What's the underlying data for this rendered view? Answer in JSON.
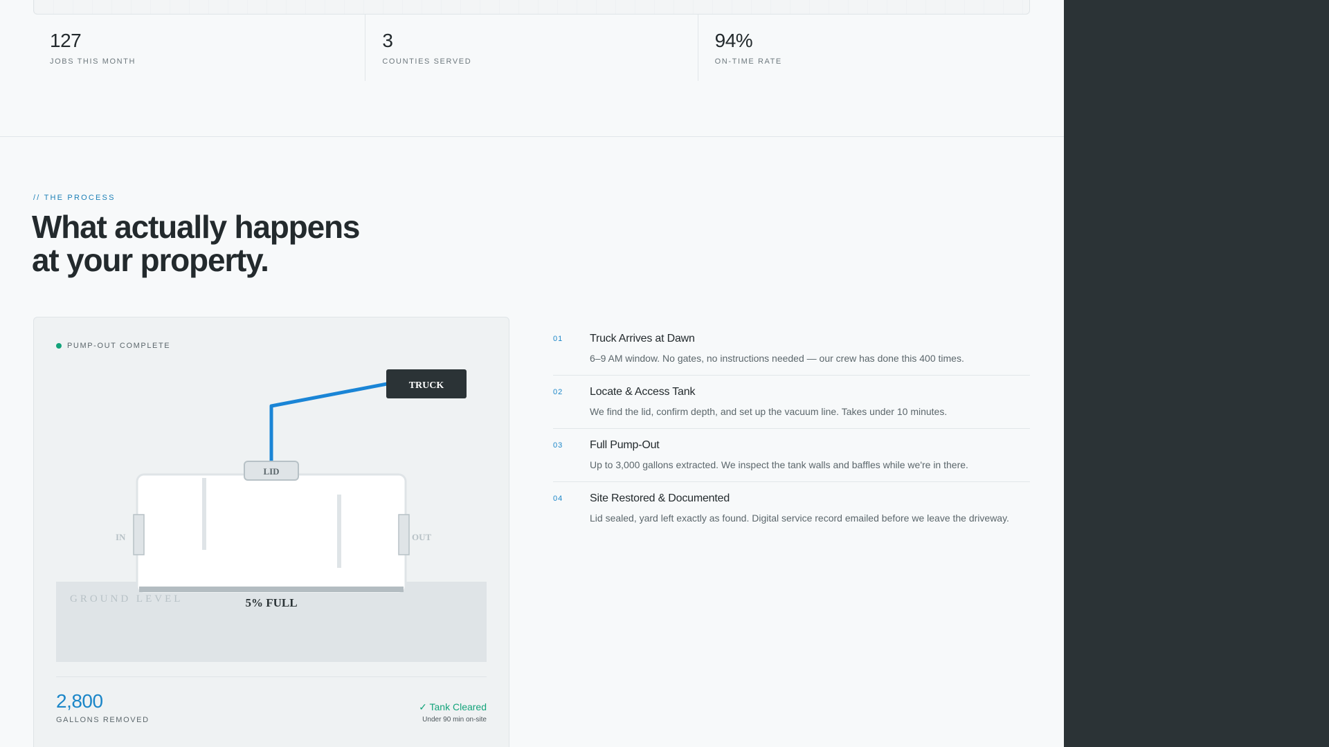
{
  "stats": [
    {
      "value": "127",
      "label": "JOBS THIS MONTH"
    },
    {
      "value": "3",
      "label": "COUNTIES SERVED"
    },
    {
      "value": "94%",
      "label": "ON-TIME RATE"
    }
  ],
  "process": {
    "eyebrow": "// THE PROCESS",
    "heading": "What actually happens\nat your property."
  },
  "diagram": {
    "status": "PUMP-OUT COMPLETE",
    "truck_label": "TRUCK",
    "lid_label": "LID",
    "in_label": "IN",
    "out_label": "OUT",
    "ground_label": "GROUND LEVEL",
    "fill_label": "5% FULL",
    "fill_fraction": 0.05,
    "gallons_value": "2,800",
    "gallons_label": "GALLONS REMOVED",
    "cleared_label": "✓ Tank Cleared",
    "cleared_sub": "Under 90 min on-site",
    "colors": {
      "hose": "#1a85d6",
      "status_dot": "#13a37a",
      "truck": "#2b3336"
    }
  },
  "steps": [
    {
      "num": "01",
      "title": "Truck Arrives at Dawn",
      "desc": "6–9 AM window. No gates, no instructions needed — our crew has done this 400 times."
    },
    {
      "num": "02",
      "title": "Locate & Access Tank",
      "desc": "We find the lid, confirm depth, and set up the vacuum line. Takes under 10 minutes."
    },
    {
      "num": "03",
      "title": "Full Pump-Out",
      "desc": "Up to 3,000 gallons extracted. We inspect the tank walls and baffles while we're in there."
    },
    {
      "num": "04",
      "title": "Site Restored & Documented",
      "desc": "Lid sealed, yard left exactly as found. Digital service record emailed before we leave the driveway."
    }
  ]
}
